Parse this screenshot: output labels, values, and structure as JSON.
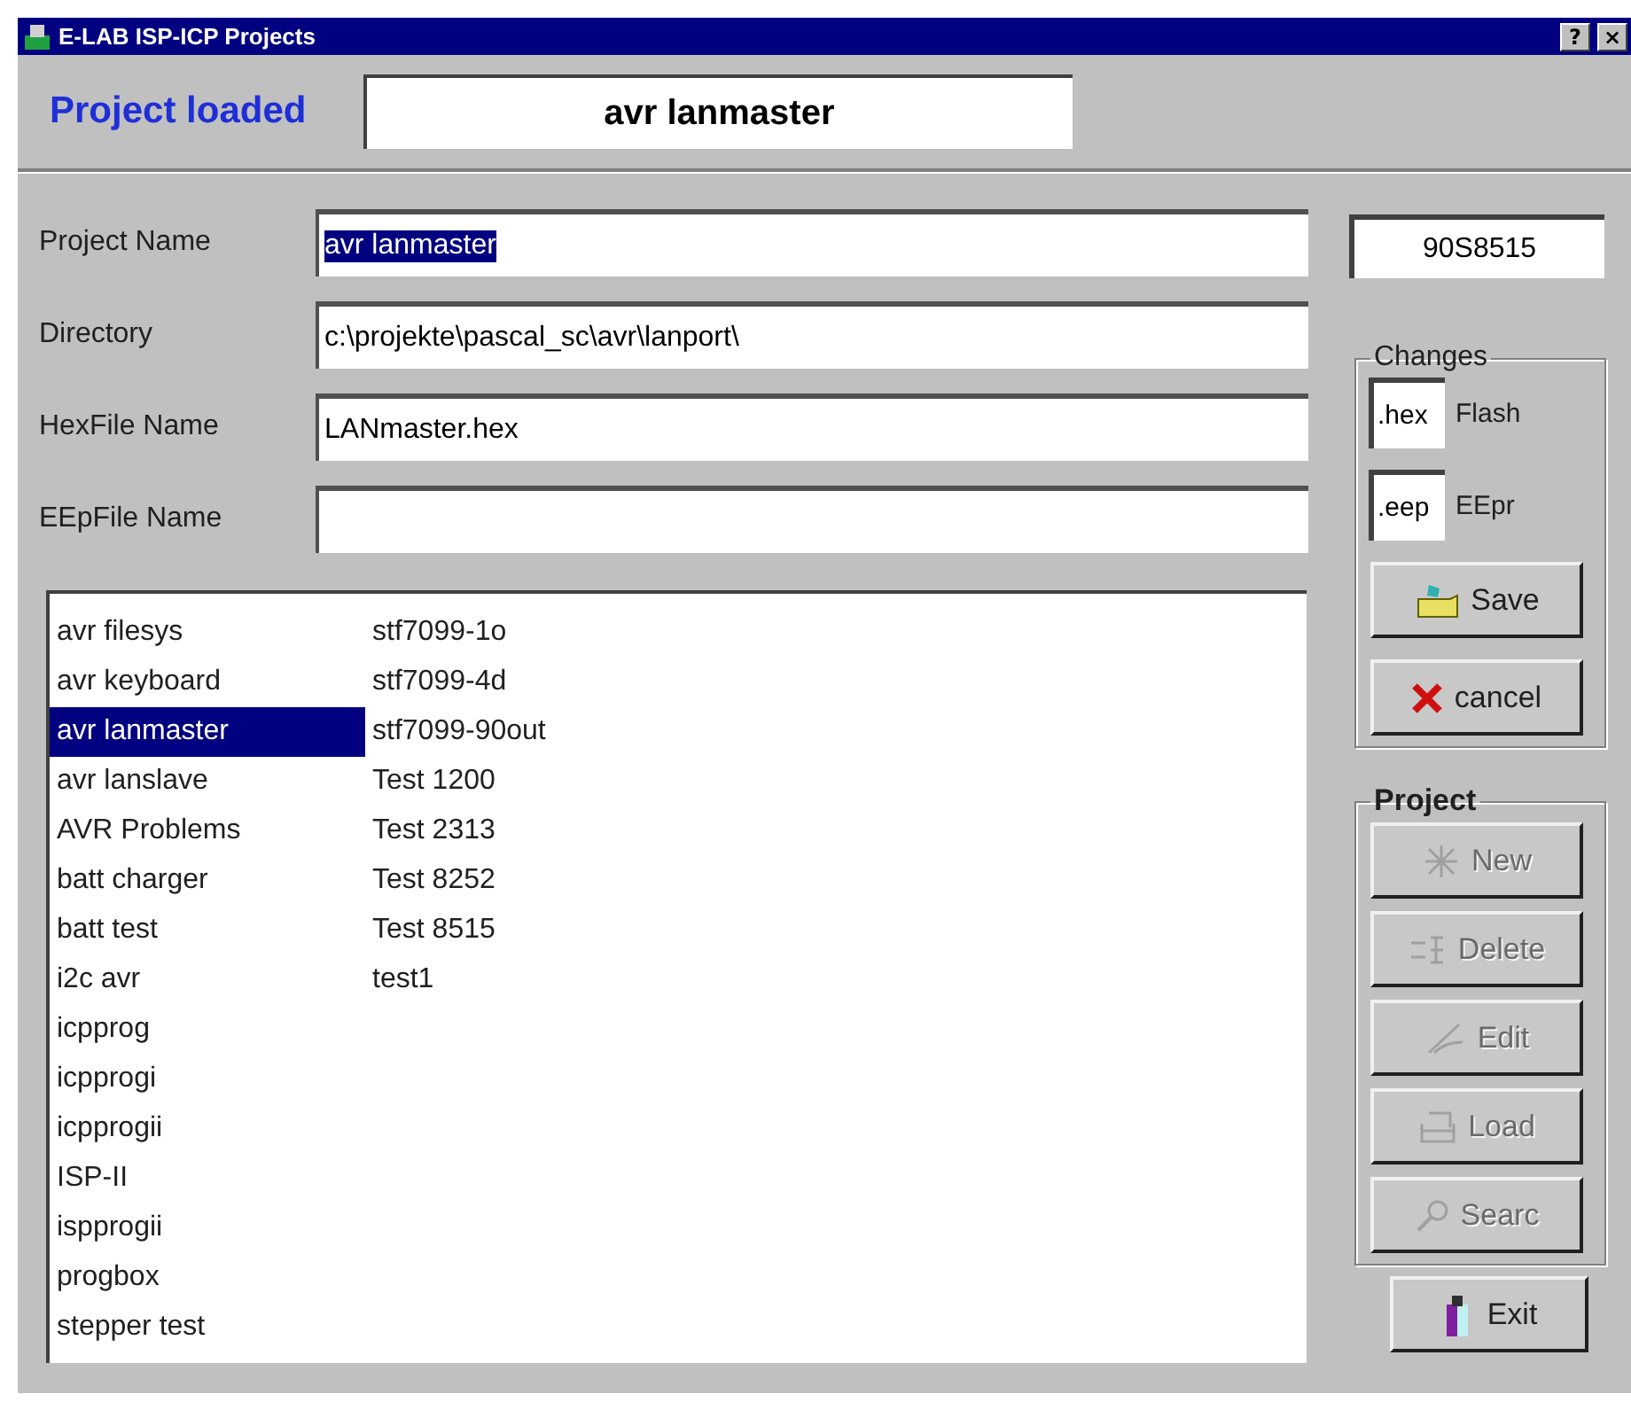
{
  "window": {
    "title": "E-LAB ISP-ICP Projects",
    "help_button": "?",
    "close_button": "×"
  },
  "header": {
    "label": "Project loaded",
    "value": "avr lanmaster"
  },
  "fields": [
    {
      "label": "Project Name",
      "value": "avr lanmaster",
      "text_selected": true
    },
    {
      "label": "Directory",
      "value": "c:\\projekte\\pascal_sc\\avr\\lanport\\",
      "text_selected": false
    },
    {
      "label": "HexFile Name",
      "value": "LANmaster.hex",
      "text_selected": false
    },
    {
      "label": "EEpFile Name"
    }
  ],
  "device": "90S8515",
  "changes": {
    "title": "Changes",
    "extensions": [
      {
        "value": ".hex",
        "label": "Flash"
      },
      {
        "value": ".eep",
        "label": "EEpr"
      }
    ],
    "buttons": [
      {
        "kind": "save",
        "label": "Save"
      },
      {
        "kind": "cancel",
        "label": "cancel"
      }
    ]
  },
  "project_list": {
    "items": [
      {
        "label": "avr filesys",
        "selected": false
      },
      {
        "label": "avr keyboard",
        "selected": false
      },
      {
        "label": "avr lanmaster",
        "selected": true
      },
      {
        "label": "avr lanslave",
        "selected": false
      },
      {
        "label": "AVR Problems",
        "selected": false
      },
      {
        "label": "batt charger",
        "selected": false
      },
      {
        "label": "batt test",
        "selected": false
      },
      {
        "label": "i2c avr",
        "selected": false
      },
      {
        "label": "icpprog",
        "selected": false
      },
      {
        "label": "icpprogi",
        "selected": false
      },
      {
        "label": "icpprogii",
        "selected": false
      },
      {
        "label": "ISP-II",
        "selected": false
      },
      {
        "label": "ispprogii",
        "selected": false
      },
      {
        "label": "progbox",
        "selected": false
      },
      {
        "label": "stepper test",
        "selected": false
      },
      {
        "label": "stf7099-1o",
        "selected": false
      },
      {
        "label": "stf7099-4d",
        "selected": false
      },
      {
        "label": "stf7099-90out",
        "selected": false
      },
      {
        "label": "Test 1200",
        "selected": false
      },
      {
        "label": "Test 2313",
        "selected": false
      },
      {
        "label": "Test 8252",
        "selected": false
      },
      {
        "label": "Test 8515",
        "selected": false
      },
      {
        "label": "test1",
        "selected": false
      }
    ]
  },
  "project": {
    "title": "Project",
    "buttons": [
      {
        "kind": "new",
        "label": "New",
        "disabled": true
      },
      {
        "kind": "delete",
        "label": "Delete",
        "disabled": true
      },
      {
        "kind": "edit",
        "label": "Edit",
        "disabled": true
      },
      {
        "kind": "load",
        "label": "Load",
        "disabled": true
      },
      {
        "kind": "search",
        "label": "Searc",
        "disabled": true
      }
    ]
  },
  "exit_button": {
    "label": "Exit"
  }
}
